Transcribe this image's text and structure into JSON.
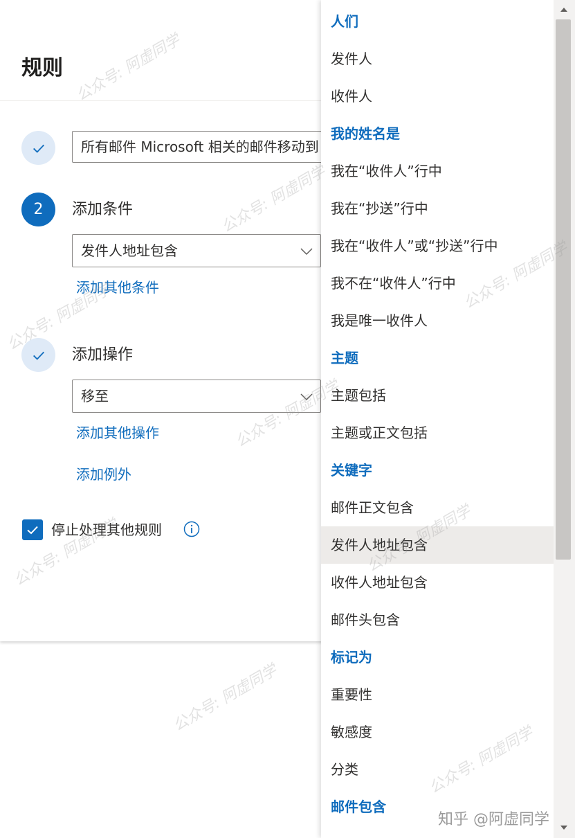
{
  "panel": {
    "title": "规则",
    "step1": {
      "rule_name": "所有邮件 Microsoft 相关的邮件移动到"
    },
    "step2": {
      "number": "2",
      "label": "添加条件",
      "condition_value": "发件人地址包含",
      "add_condition_link": "添加其他条件"
    },
    "step3": {
      "label": "添加操作",
      "action_value": "移至",
      "add_action_link": "添加其他操作",
      "add_exception_link": "添加例外"
    },
    "stop_processing": {
      "label": "停止处理其他规则",
      "checked": true
    }
  },
  "menu": {
    "rows": [
      {
        "type": "header",
        "label": "人们"
      },
      {
        "type": "item",
        "label": "发件人"
      },
      {
        "type": "item",
        "label": "收件人"
      },
      {
        "type": "header",
        "label": "我的姓名是"
      },
      {
        "type": "item",
        "label": "我在“收件人”行中"
      },
      {
        "type": "item",
        "label": "我在“抄送”行中"
      },
      {
        "type": "item",
        "label": "我在“收件人”或“抄送”行中"
      },
      {
        "type": "item",
        "label": "我不在“收件人”行中"
      },
      {
        "type": "item",
        "label": "我是唯一收件人"
      },
      {
        "type": "header",
        "label": "主题"
      },
      {
        "type": "item",
        "label": "主题包括"
      },
      {
        "type": "item",
        "label": "主题或正文包括"
      },
      {
        "type": "header",
        "label": "关键字"
      },
      {
        "type": "item",
        "label": "邮件正文包含"
      },
      {
        "type": "item",
        "label": "发件人地址包含",
        "selected": true
      },
      {
        "type": "item",
        "label": "收件人地址包含"
      },
      {
        "type": "item",
        "label": "邮件头包含"
      },
      {
        "type": "header",
        "label": "标记为"
      },
      {
        "type": "item",
        "label": "重要性"
      },
      {
        "type": "item",
        "label": "敏感度"
      },
      {
        "type": "item",
        "label": "分类"
      },
      {
        "type": "header",
        "label": "邮件包含"
      }
    ]
  },
  "watermark": {
    "text": "公众号: 阿虚同学",
    "footer": "知乎 @阿虚同学"
  },
  "colors": {
    "accent": "#0f6cbd",
    "selected_bg": "#edebe9",
    "step_done_bg": "#dfeaf7"
  }
}
